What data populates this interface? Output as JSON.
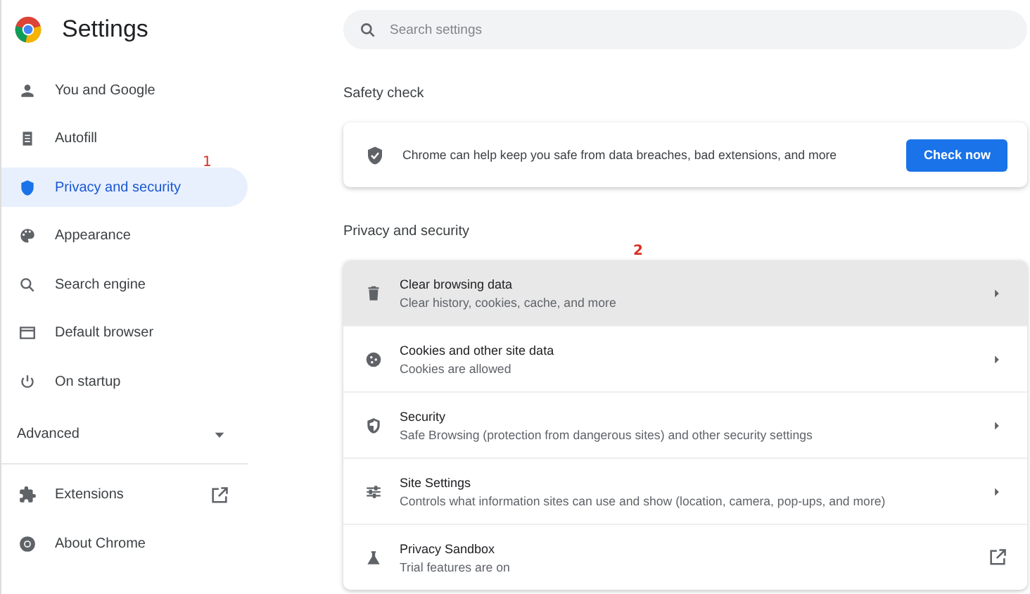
{
  "header": {
    "title": "Settings"
  },
  "search": {
    "placeholder": "Search settings"
  },
  "sidebar": {
    "items": [
      {
        "label": "You and Google",
        "selected": false
      },
      {
        "label": "Autofill",
        "selected": false
      },
      {
        "label": "Privacy and security",
        "selected": true,
        "annotation": "1"
      },
      {
        "label": "Appearance",
        "selected": false
      },
      {
        "label": "Search engine",
        "selected": false
      },
      {
        "label": "Default browser",
        "selected": false
      },
      {
        "label": "On startup",
        "selected": false
      }
    ],
    "advanced": {
      "label": "Advanced",
      "expanded": false
    },
    "footer_items": [
      {
        "label": "Extensions",
        "external": true
      },
      {
        "label": "About Chrome",
        "external": false
      }
    ]
  },
  "safety_check": {
    "heading": "Safety check",
    "text": "Chrome can help keep you safe from data breaches, bad extensions, and more",
    "button": "Check now"
  },
  "privacy": {
    "heading": "Privacy and security",
    "rows": [
      {
        "title": "Clear browsing data",
        "subtitle": "Clear history, cookies, cache, and more",
        "kind": "arrow",
        "selected": true,
        "annotation": "2"
      },
      {
        "title": "Cookies and other site data",
        "subtitle": "Cookies are allowed",
        "kind": "arrow",
        "selected": false
      },
      {
        "title": "Security",
        "subtitle": "Safe Browsing (protection from dangerous sites) and other security settings",
        "kind": "arrow",
        "selected": false
      },
      {
        "title": "Site Settings",
        "subtitle": "Controls what information sites can use and show (location, camera, pop-ups, and more)",
        "kind": "arrow",
        "selected": false
      },
      {
        "title": "Privacy Sandbox",
        "subtitle": "Trial features are on",
        "kind": "external",
        "selected": false
      }
    ]
  }
}
